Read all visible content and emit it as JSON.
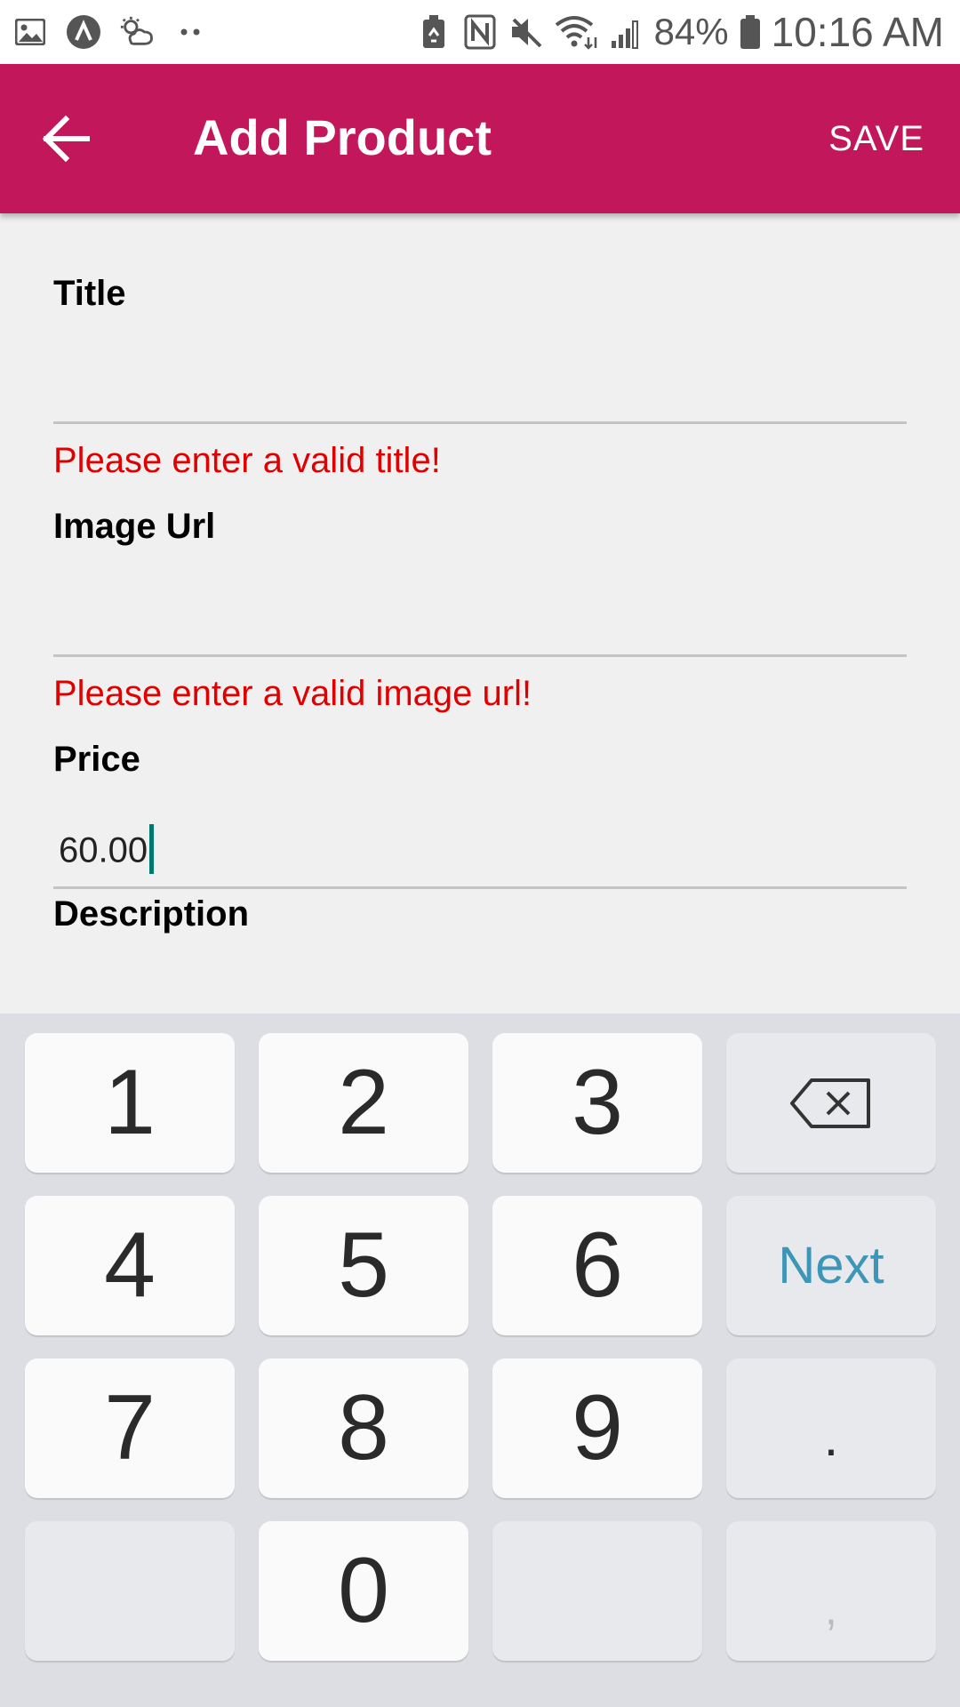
{
  "status_bar": {
    "left_icons": [
      "image-icon",
      "app-a-icon",
      "weather-icon",
      "more-dots-icon"
    ],
    "right_icons": [
      "battery-saver-icon",
      "nfc-icon",
      "mute-icon",
      "wifi-icon",
      "signal-icon",
      "battery-icon"
    ],
    "battery": "84%",
    "time": "10:16 AM"
  },
  "app_bar": {
    "back_icon": "arrow-left-icon",
    "title": "Add Product",
    "save_label": "SAVE",
    "color": "#c2185b"
  },
  "form": {
    "title_field": {
      "label": "Title",
      "value": "",
      "error": "Please enter a valid title!"
    },
    "image_url_field": {
      "label": "Image Url",
      "value": "",
      "error": "Please enter a valid image url!"
    },
    "price_field": {
      "label": "Price",
      "value": "60.00"
    },
    "description_field": {
      "label": "Description"
    },
    "error_color": "#e00000"
  },
  "keyboard": {
    "keys": {
      "k1": "1",
      "k2": "2",
      "k3": "3",
      "backspace_icon": "backspace-icon",
      "k4": "4",
      "k5": "5",
      "k6": "6",
      "next": "Next",
      "k7": "7",
      "k8": "8",
      "k9": "9",
      "dot": ".",
      "k0": "0",
      "comma": ","
    }
  }
}
